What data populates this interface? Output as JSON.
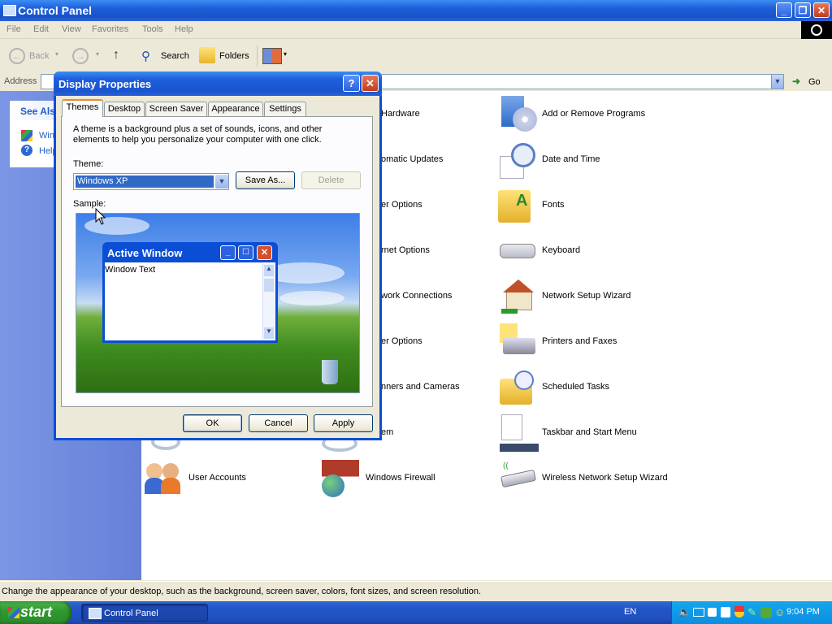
{
  "window": {
    "title": "Control Panel",
    "menu": [
      "File",
      "Edit",
      "View",
      "Favorites",
      "Tools",
      "Help"
    ],
    "toolbar": {
      "back": "Back",
      "search": "Search",
      "folders": "Folders"
    },
    "address_label": "Address",
    "go_label": "Go",
    "see_also": {
      "title": "See Als",
      "items": [
        "Win",
        "Help"
      ]
    }
  },
  "items": {
    "col2": [
      "Hardware",
      "omatic Updates",
      "er Options",
      "rnet Options",
      "work Connections",
      "er Options",
      "nners and Cameras",
      "em",
      "Windows Firewall"
    ],
    "col3": [
      "Add or Remove Programs",
      "Date and Time",
      "Fonts",
      "Keyboard",
      "Network Setup Wizard",
      "Printers and Faxes",
      "Scheduled Tasks",
      "Taskbar and Start Menu",
      "Wireless Network Setup Wizard"
    ],
    "col1": [
      "User Accounts"
    ]
  },
  "status": "Change the appearance of your desktop, such as the background, screen saver, colors, font sizes, and screen resolution.",
  "taskbar": {
    "start": "start",
    "task": "Control Panel",
    "lang": "EN",
    "clock": "9:04 PM"
  },
  "dialog": {
    "title": "Display Properties",
    "help": "?",
    "tabs": [
      "Themes",
      "Desktop",
      "Screen Saver",
      "Appearance",
      "Settings"
    ],
    "description": "A theme is a background plus a set of sounds, icons, and other elements to help you personalize your computer with one click.",
    "theme_label": "Theme:",
    "theme_value": "Windows XP",
    "save_as": "Save As...",
    "delete": "Delete",
    "sample_label": "Sample:",
    "active_window_title": "Active Window",
    "window_text": "Window Text",
    "ok": "OK",
    "cancel": "Cancel",
    "apply": "Apply"
  },
  "colors": {
    "xp_blue": "#0b4ed6",
    "start_green": "#2f9a2f",
    "tray_blue": "#0d8de0"
  }
}
